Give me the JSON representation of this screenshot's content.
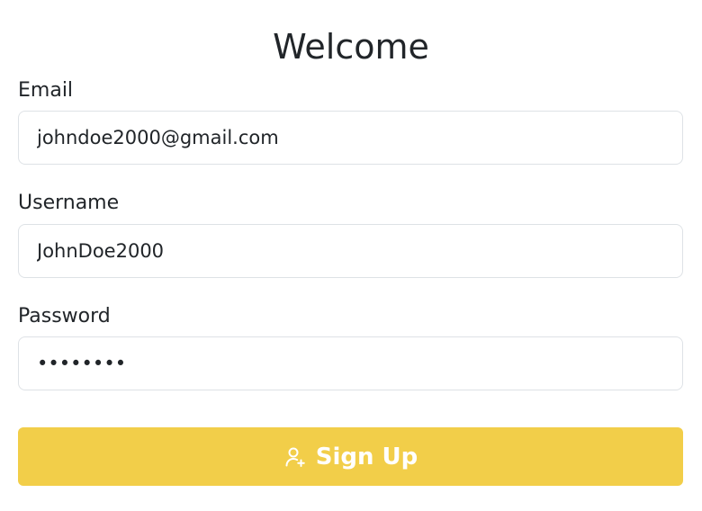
{
  "form": {
    "title": "Welcome",
    "email": {
      "label": "Email",
      "value": "johndoe2000@gmail.com"
    },
    "username": {
      "label": "Username",
      "value": "JohnDoe2000"
    },
    "password": {
      "label": "Password",
      "value": "password"
    },
    "submit": {
      "label": "Sign Up",
      "icon": "user-plus-icon"
    }
  },
  "colors": {
    "button_bg": "#f2ce49",
    "button_text": "#ffffff",
    "text": "#212529",
    "border": "#dee2e6"
  }
}
